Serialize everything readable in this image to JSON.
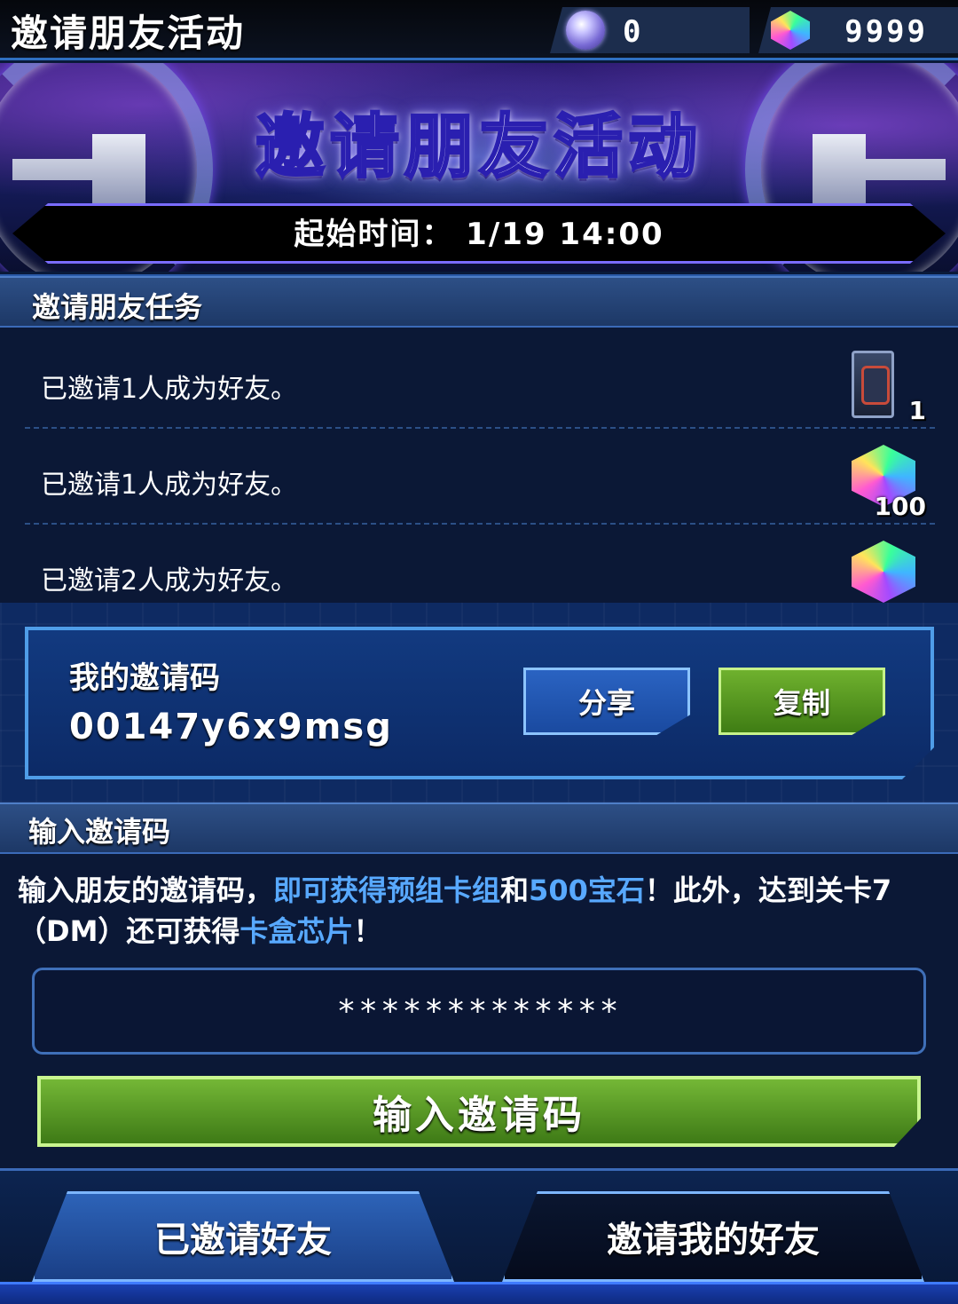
{
  "header": {
    "title": "邀请朋友活动",
    "currency_orb": {
      "icon": "orb-icon",
      "value": "0"
    },
    "currency_gem": {
      "icon": "gem-icon",
      "value": "9999"
    }
  },
  "banner": {
    "title": "邀请朋友活动",
    "start_time": "起始时间： 1/19 14:00"
  },
  "tasks": {
    "header": "邀请朋友任务",
    "items": [
      {
        "text": "已邀请1人成为好友。",
        "reward_icon": "card-deck-icon",
        "reward_qty": "1"
      },
      {
        "text": "已邀请1人成为好友。",
        "reward_icon": "gem-icon",
        "reward_qty": "100"
      },
      {
        "text": "已邀请2人成为好友。",
        "reward_icon": "gem-icon",
        "reward_qty": ""
      }
    ]
  },
  "my_code": {
    "label": "我的邀请码",
    "value": "00147y6x9msg",
    "share_label": "分享",
    "copy_label": "复制"
  },
  "enter_code": {
    "header": "输入邀请码",
    "desc_parts": [
      "输入朋友的邀请码，",
      "即可获得预组卡组",
      "和",
      "500宝石",
      "！此外，达到关卡7（DM）还可获得",
      "卡盒芯片",
      "！"
    ],
    "input_placeholder": "*************",
    "submit_label": "输入邀请码"
  },
  "bottom_tabs": {
    "invited_label": "已邀请好友",
    "invite_label": "邀请我的好友"
  },
  "colors": {
    "accent_blue": "#58a9ff",
    "button_green": "#74b736",
    "frame_blue": "#4f9de8"
  }
}
